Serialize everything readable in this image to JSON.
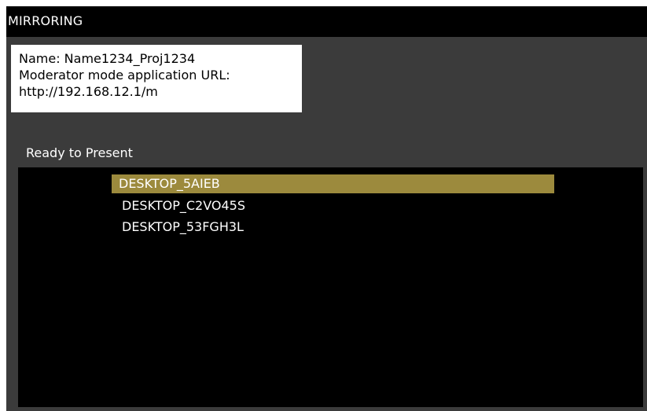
{
  "window": {
    "title": "MIRRORING"
  },
  "info": {
    "name_line": "Name: Name1234_Proj1234",
    "moderator_label": "Moderator mode application URL:",
    "moderator_url": "http://192.168.12.1/m"
  },
  "status": {
    "text": "Ready to Present"
  },
  "devices": {
    "selected_index": 0,
    "items": [
      {
        "label": "DESKTOP_5AIEB"
      },
      {
        "label": "DESKTOP_C2VO45S"
      },
      {
        "label": "DESKTOP_53FGH3L"
      }
    ]
  },
  "colors": {
    "background": "#3b3b3b",
    "title_bar": "#000000",
    "list_background": "#000000",
    "selection": "#9c8a3d",
    "info_box": "#ffffff"
  }
}
